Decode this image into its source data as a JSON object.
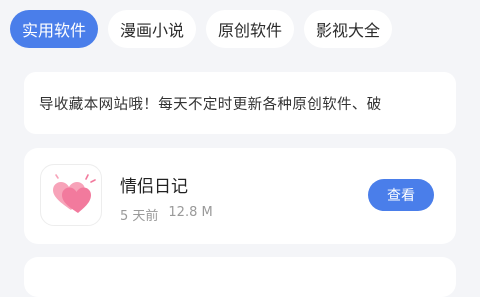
{
  "tabs": [
    {
      "label": "实用软件",
      "active": true
    },
    {
      "label": "漫画小说",
      "active": false
    },
    {
      "label": "原创软件",
      "active": false
    },
    {
      "label": "影视大全",
      "active": false
    }
  ],
  "notice": {
    "text": "导收藏本网站哦！每天不定时更新各种原创软件、破"
  },
  "app_card": {
    "icon": "twin-hearts-icon",
    "title": "情侣日记",
    "time": "5 天前",
    "size": "12.8 M",
    "button_label": "查看"
  },
  "colors": {
    "accent": "#4a7eea",
    "background": "#f4f5f8",
    "card": "#ffffff",
    "heart": "#f58aa8"
  }
}
